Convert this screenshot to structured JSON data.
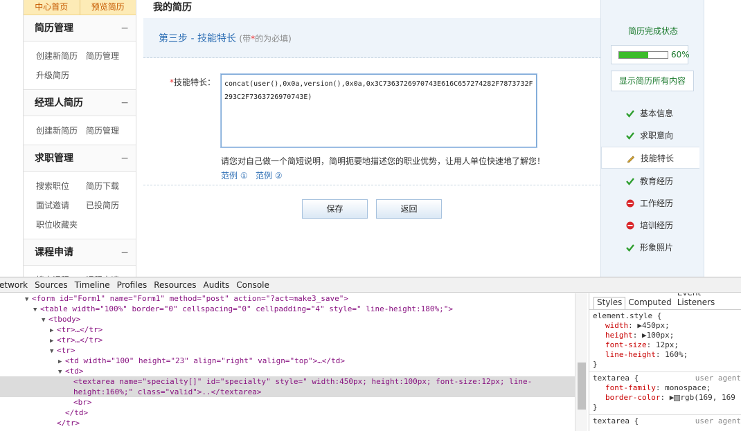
{
  "sidebar": {
    "topnav": [
      "中心首页",
      "预览简历"
    ],
    "sections": [
      {
        "title": "简历管理",
        "toggle": "−",
        "links": [
          [
            "创建新简历",
            "简历管理"
          ],
          [
            "升级简历"
          ]
        ]
      },
      {
        "title": "经理人简历",
        "toggle": "−",
        "links": [
          [
            "创建新简历",
            "简历管理"
          ]
        ]
      },
      {
        "title": "求职管理",
        "toggle": "−",
        "links": [
          [
            "搜索职位",
            "简历下载"
          ],
          [
            "面试邀请",
            "已投简历"
          ],
          [
            "职位收藏夹"
          ]
        ]
      },
      {
        "title": "课程申请",
        "toggle": "−",
        "links": [
          [
            "搜索课程",
            "课程申请"
          ]
        ]
      }
    ]
  },
  "main": {
    "title": "我的简历",
    "step_title": "第三步 - 技能特长",
    "required_note_pre": "(带",
    "required_star": "*",
    "required_note_post": "的为必填)",
    "field_star": "*",
    "field_label": "技能特长：",
    "textarea_value": "concat(user(),0x0a,version(),0x0a,0x3C7363726970743E616C657274282F7873732F293C2F7363726970743E)",
    "hint": "请您对自己做一个简短说明，简明扼要地描述您的职业优势，让用人单位快速地了解您！",
    "example1": "范例 ①",
    "example2": "范例 ②",
    "save_label": "保存",
    "back_label": "返回"
  },
  "right": {
    "title": "简历完成状态",
    "progress_pct": 60,
    "progress_text": "60%",
    "show_all": "显示简历所有内容",
    "items": [
      {
        "label": "基本信息",
        "status": "done",
        "icon": "check-icon"
      },
      {
        "label": "求职意向",
        "status": "done",
        "icon": "check-icon"
      },
      {
        "label": "技能特长",
        "status": "editing",
        "icon": "pencil-icon"
      },
      {
        "label": "教育经历",
        "status": "done",
        "icon": "check-icon"
      },
      {
        "label": "工作经历",
        "status": "missing",
        "icon": "minus-circle-icon"
      },
      {
        "label": "培训经历",
        "status": "missing",
        "icon": "minus-circle-icon"
      },
      {
        "label": "形象照片",
        "status": "done",
        "icon": "check-icon"
      }
    ]
  },
  "devtools": {
    "tabs": [
      "etwork",
      "Sources",
      "Timeline",
      "Profiles",
      "Resources",
      "Audits",
      "Console"
    ],
    "code_lines": [
      "<form id=\"Form1\" name=\"Form1\" method=\"post\" action=\"?act=make3_save\">",
      "<table width=\"100%\" border=\"0\" cellspacing=\"0\" cellpadding=\"4\" style=\" line-height:180%;\">",
      "<tbody>",
      "<tr>…</tr>",
      "<tr>…</tr>",
      "<tr>",
      "<td width=\"100\" height=\"23\" align=\"right\" valign=\"top\">…</td>",
      "<td>",
      "<textarea name=\"specialty[]\" id=\"specialty\" style=\" width:450px; height:100px; font-size:12px; line-",
      "height:160%;\" class=\"valid\">..</textarea>",
      "<br>",
      "</td>",
      "</tr>"
    ],
    "style_tabs": [
      "Styles",
      "Computed",
      "Event Listeners"
    ],
    "element_style_selector": "element.style {",
    "element_style_props": [
      [
        "width",
        "450px;"
      ],
      [
        "height",
        "100px;"
      ],
      [
        "font-size",
        "12px;"
      ],
      [
        "line-height",
        "160%;"
      ]
    ],
    "ua_rule_selector": "textarea {",
    "ua_label": "user agent",
    "ua_props": [
      [
        "font-family",
        "monospace;"
      ],
      [
        "border-color",
        "rgb(169, 169"
      ]
    ],
    "ua_rule2_selector": "textarea {",
    "close_brace": "}"
  }
}
